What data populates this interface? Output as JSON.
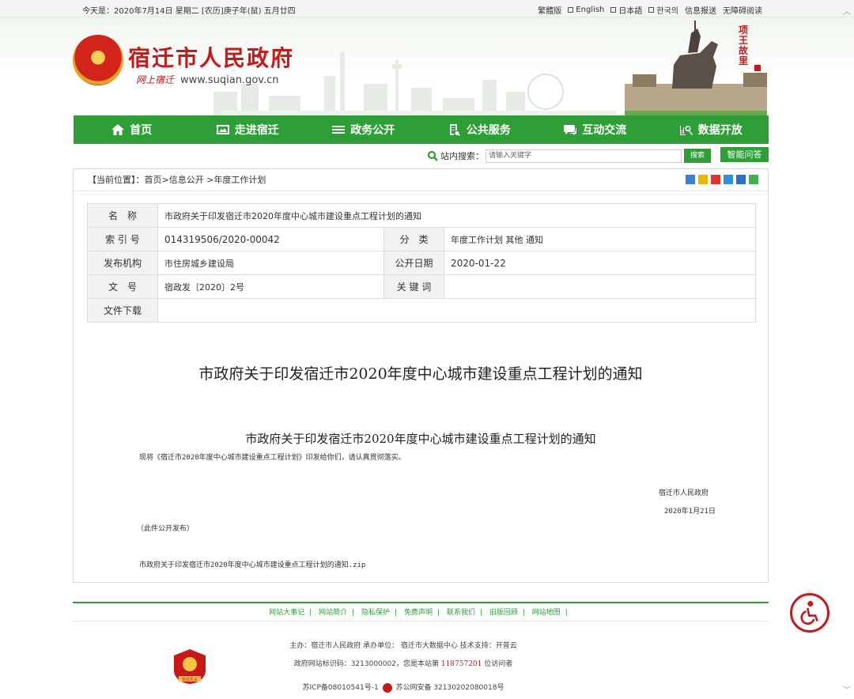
{
  "topbar": {
    "date": "今天是：2020年7月14日 星期二 [农历]庚子年(鼠) 五月廿四",
    "langs": [
      "繁體版",
      "English",
      "日本語",
      "한국의"
    ],
    "links": [
      "信息报送",
      "无障碍阅读"
    ]
  },
  "header": {
    "site_name": "宿迁市人民政府",
    "site_handwriting": "网上宿迁",
    "site_url": "www.suqian.gov.cn",
    "vertical_text": "项王故里"
  },
  "nav": [
    {
      "label": "首页",
      "icon": "home-icon"
    },
    {
      "label": "走进宿迁",
      "icon": "picture-icon"
    },
    {
      "label": "政务公开",
      "icon": "list-icon"
    },
    {
      "label": "公共服务",
      "icon": "document-icon"
    },
    {
      "label": "互动交流",
      "icon": "chat-icon"
    },
    {
      "label": "数据开放",
      "icon": "chart-search-icon"
    }
  ],
  "search": {
    "label": "站内搜索：",
    "placeholder": "请输入关键字",
    "button": "搜索",
    "qa_button": "智能问答"
  },
  "breadcrumb": {
    "label": "【当前位置】",
    "path": "：首页>信息公开 >年度工作计划"
  },
  "meta": {
    "name_label": "名　称",
    "name_value": "市政府关于印发宿迁市2020年度中心城市建设重点工程计划的通知",
    "index_label": "索 引 号",
    "index_value": "014319506/2020-00042",
    "category_label": "分　类",
    "category_value": "年度工作计划  其他  通知",
    "org_label": "发布机构",
    "org_value": "市住房城乡建设局",
    "date_label": "公开日期",
    "date_value": "2020-01-22",
    "docno_label": "文　号",
    "docno_value": "宿政发〔2020〕2号",
    "keyword_label": "关 键 词",
    "keyword_value": "",
    "download_label": "文件下载",
    "download_value": ""
  },
  "article": {
    "title": "市政府关于印发宿迁市2020年度中心城市建设重点工程计划的通知",
    "subtitle": "市政府关于印发宿迁市2020年度中心城市建设重点工程计划的通知",
    "body": "现将《宿迁市2020年度中心城市建设重点工程计划》印发给你们，请认真贯彻落实。",
    "sign_org": "宿迁市人民政府",
    "sign_date": "2020年1月21日",
    "note": "（此件公开发布）",
    "attachment": "市政府关于印发宿迁市2020年度中心城市建设重点工程计划的通知.zip"
  },
  "footer": {
    "links": [
      "网站大事记",
      "网站简介",
      "隐私保护",
      "免费声明",
      "联系我们",
      "旧版回顾",
      "网站地图"
    ],
    "line1": "主办：宿迁市人民政府 承办单位： 宿迁市大数据中心 技术支持：开普云",
    "line2_prefix": "政府网站标识码：3213000002，您是本站第",
    "visits": "118757201",
    "line2_suffix": "位访问者",
    "icp": "苏ICP备08010541号-1",
    "police": "苏公网安备 32130202080018号",
    "badge_text": "党政机关"
  },
  "colors": {
    "brand_green": "#2e9e36",
    "brand_red": "#c8191a"
  }
}
